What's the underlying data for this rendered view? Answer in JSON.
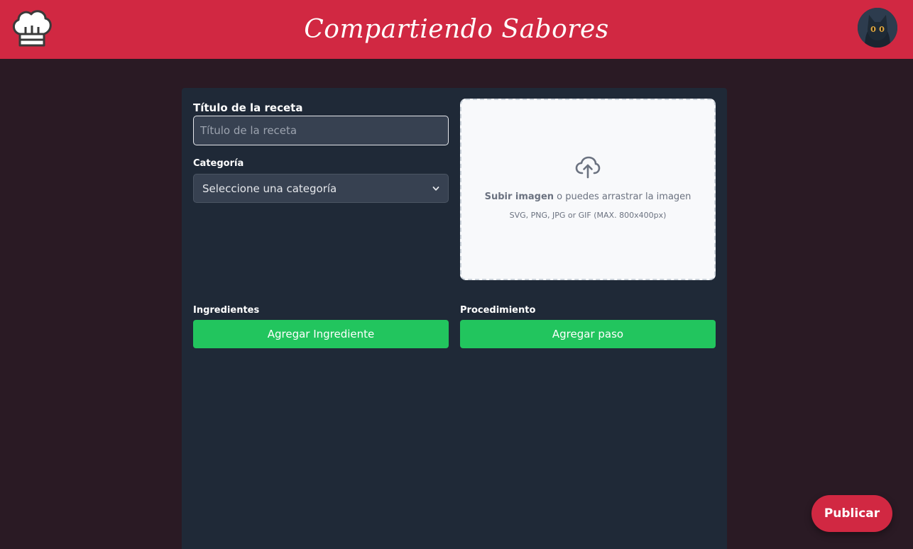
{
  "header": {
    "brand": "Compartiendo Sabores",
    "logo_icon": "chef-hat-icon",
    "avatar_icon": "cat-avatar"
  },
  "form": {
    "title_label": "Título de la receta",
    "title_placeholder": "Título de la receta",
    "title_value": "",
    "category_label": "Categoría",
    "category_selected": "Seleccione una categoría",
    "upload": {
      "icon": "cloud-upload-icon",
      "action_text": "Subir imagen",
      "rest_text": " o puedes arrastrar la imagen",
      "hint": "SVG, PNG, JPG or GIF (MAX. 800x400px)"
    },
    "ingredients_label": "Ingredientes",
    "add_ingredient_label": "Agregar Ingrediente",
    "procedure_label": "Procedimiento",
    "add_step_label": "Agregar paso"
  },
  "publish_label": "Publicar",
  "colors": {
    "brand_red": "#d12842",
    "page_bg": "#2a1a24",
    "panel_bg": "#1f2937",
    "green": "#22c55e"
  }
}
